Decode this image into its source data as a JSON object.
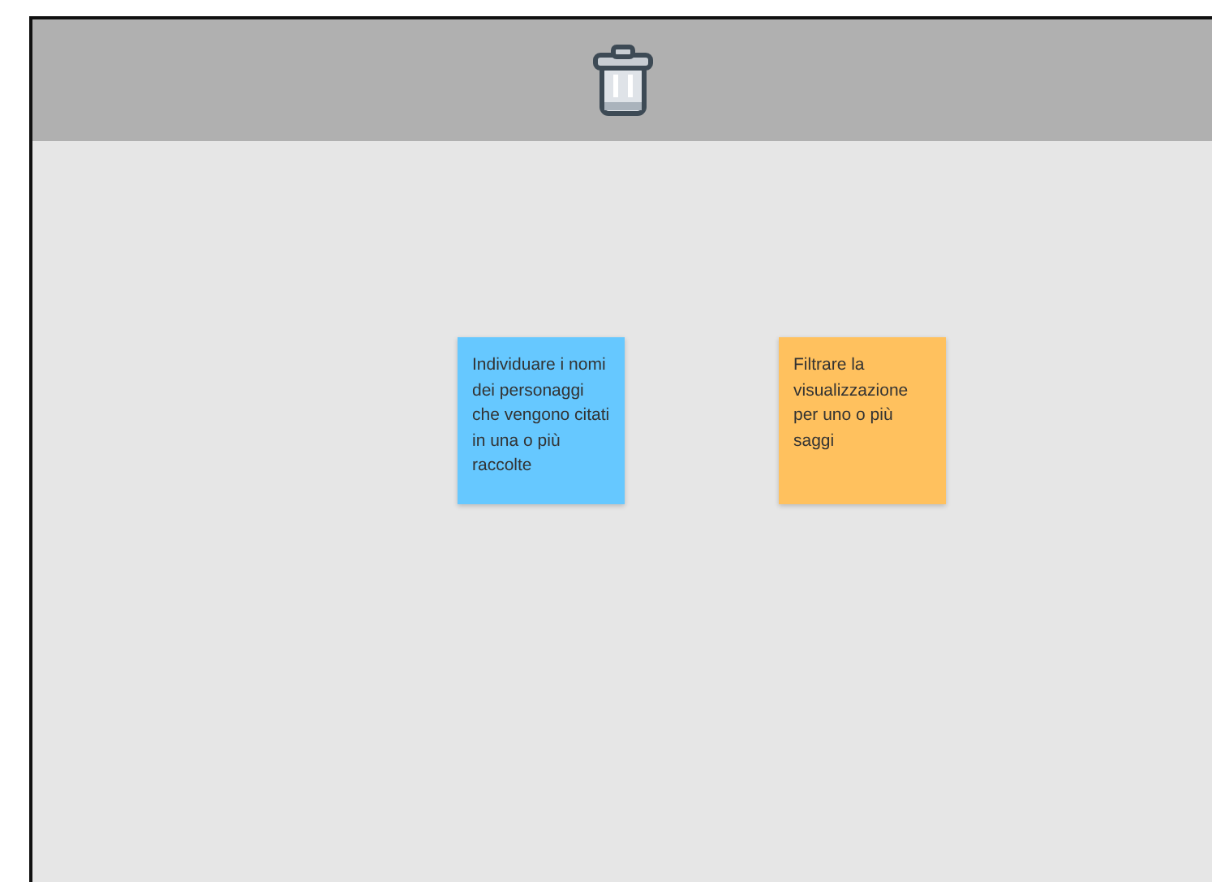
{
  "notes": [
    {
      "text": "Individuare i nomi dei personaggi che vengono citati in una o più raccolte",
      "color": "#66c8ff"
    },
    {
      "text": "Filtrare la visualizzazione per uno o più saggi",
      "color": "#ffc15e"
    }
  ]
}
